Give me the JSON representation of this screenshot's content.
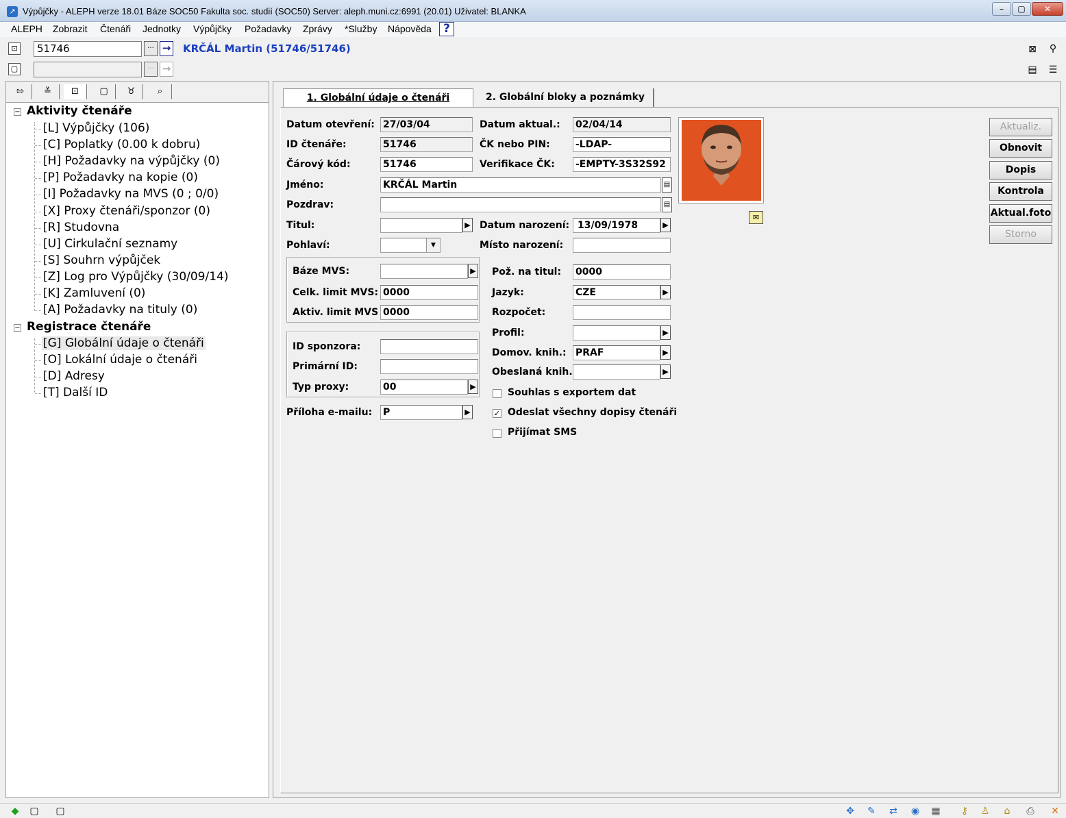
{
  "window": {
    "title": "Výpůjčky - ALEPH verze 18.01  Báze SOC50 Fakulta soc. studií (SOC50)  Server: aleph.muni.cz:6991 (20.01)  Uživatel: BLANKA"
  },
  "menu": [
    "ALEPH",
    "Zobrazit",
    "Čtenáři",
    "Jednotky",
    "Výpůjčky",
    "Požadavky",
    "Zprávy",
    "*Služby",
    "Nápověda"
  ],
  "help_label": "?",
  "patron_bar": {
    "patron_id": "51746",
    "patron_name": "KRČÁL Martin (51746/51746)",
    "item_id": ""
  },
  "left_tree": {
    "groups": [
      {
        "label": "Aktivity čtenáře",
        "items": [
          "[L] Výpůjčky (106)",
          "[C] Poplatky (0.00 k dobru)",
          "[H] Požadavky na výpůjčky (0)",
          "[P] Požadavky na kopie (0)",
          "[I] Požadavky na MVS (0 ; 0/0)",
          "[X] Proxy čtenáři/sponzor (0)",
          "[R] Studovna",
          "[U] Cirkulační seznamy",
          "[S] Souhrn výpůjček",
          "[Z] Log pro Výpůjčky (30/09/14)",
          "[K] Zamluvení (0)",
          "[A] Požadavky na tituly (0)"
        ]
      },
      {
        "label": "Registrace čtenáře",
        "items": [
          "[G] Globální údaje o čtenáři",
          "[O] Lokální údaje o čtenáři",
          "[D] Adresy",
          "[T] Další ID"
        ]
      }
    ],
    "selected_item": "[G] Globální údaje o čtenáři"
  },
  "tabs": [
    "1. Globální údaje o čtenáři",
    "2. Globální bloky a poznámky"
  ],
  "active_tab": "1. Globální údaje o čtenáři",
  "form": {
    "datum_otevreni": {
      "label": "Datum otevření:",
      "value": "27/03/04"
    },
    "datum_aktual": {
      "label": "Datum aktual.:",
      "value": "02/04/14"
    },
    "id_ctenare": {
      "label": "ID čtenáře:",
      "value": "51746"
    },
    "ck_pin": {
      "label": "ČK nebo PIN:",
      "value": "-LDAP-"
    },
    "carovy_kod": {
      "label": "Čárový kód:",
      "value": "51746"
    },
    "verifikace_ck": {
      "label": "Verifikace ČK:",
      "value": "-EMPTY-3S32S92"
    },
    "jmeno": {
      "label": "Jméno:",
      "value": "KRČÁL Martin"
    },
    "pozdrav": {
      "label": "Pozdrav:",
      "value": ""
    },
    "titul": {
      "label": "Titul:",
      "value": ""
    },
    "datum_narozeni": {
      "label": "Datum narození:",
      "value": "13/09/1978"
    },
    "pohlavi": {
      "label": "Pohlaví:",
      "value": ""
    },
    "misto_narozeni": {
      "label": "Místo narození:",
      "value": ""
    },
    "baze_mvs": {
      "label": "Báze MVS:",
      "value": ""
    },
    "celk_limit_mvs": {
      "label": "Celk. limit MVS:",
      "value": "0000"
    },
    "aktiv_limit_mvs": {
      "label": "Aktiv. limit MVS",
      "value": "0000"
    },
    "poz_na_titul": {
      "label": "Pož. na titul:",
      "value": "0000"
    },
    "jazyk": {
      "label": "Jazyk:",
      "value": "CZE"
    },
    "rozpocet": {
      "label": "Rozpočet:",
      "value": ""
    },
    "profil": {
      "label": "Profil:",
      "value": ""
    },
    "id_sponzora": {
      "label": "ID sponzora:",
      "value": ""
    },
    "primarni_id": {
      "label": "Primární ID:",
      "value": ""
    },
    "typ_proxy": {
      "label": "Typ proxy:",
      "value": "00"
    },
    "domov_knih": {
      "label": "Domov. knih.:",
      "value": "PRAF"
    },
    "obeslana_knih": {
      "label": "Obeslaná knih.:",
      "value": ""
    },
    "priloha_emailu": {
      "label": "Příloha e-mailu:",
      "value": "P"
    },
    "souhlas_export": {
      "label": "Souhlas s exportem dat",
      "checked": false
    },
    "odeslat_dopisy": {
      "label": "Odeslat všechny dopisy čtenáři",
      "checked": true
    },
    "prijimat_sms": {
      "label": "Přijímat SMS",
      "checked": false
    }
  },
  "actions": [
    {
      "label": "Aktualiz.",
      "enabled": false
    },
    {
      "label": "Obnovit",
      "enabled": true
    },
    {
      "label": "Dopis",
      "enabled": true
    },
    {
      "label": "Kontrola",
      "enabled": true
    },
    {
      "label": "Aktual.foto",
      "enabled": true
    },
    {
      "label": "Storno",
      "enabled": false
    }
  ],
  "colors": {
    "patron_name": "#1a3fc0",
    "photo_background": "#e0521f"
  }
}
